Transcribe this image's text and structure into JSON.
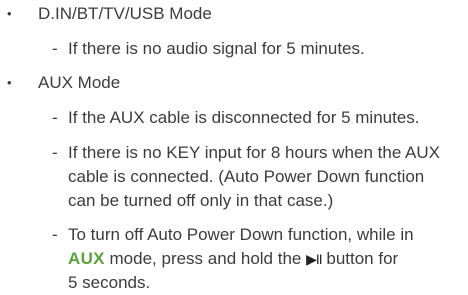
{
  "modes": [
    {
      "bullet": "•",
      "title": "D.IN/BT/TV/USB Mode",
      "conditions": [
        {
          "dash": "-",
          "lines": [
            "If there is no audio signal for 5 minutes."
          ]
        }
      ]
    },
    {
      "bullet": "•",
      "title": "AUX Mode",
      "conditions": [
        {
          "dash": "-",
          "lines": [
            "If the AUX cable is disconnected for 5 minutes."
          ]
        },
        {
          "dash": "-",
          "lines": [
            "If there is no KEY input for 8 hours when the AUX",
            "cable is connected. (Auto Power Down function",
            "can be turned off only in that case.)"
          ]
        },
        {
          "dash": "-",
          "line1_before": "To turn off Auto Power Down function, while in",
          "line2_keyword": "AUX",
          "line2_middle": " mode, press and hold the ",
          "line2_button_icon": "▶II",
          "line2_after": " button for",
          "line3": "5 seconds."
        }
      ]
    }
  ],
  "colors": {
    "text": "#3c3c3c",
    "highlight": "#5aa33a"
  }
}
